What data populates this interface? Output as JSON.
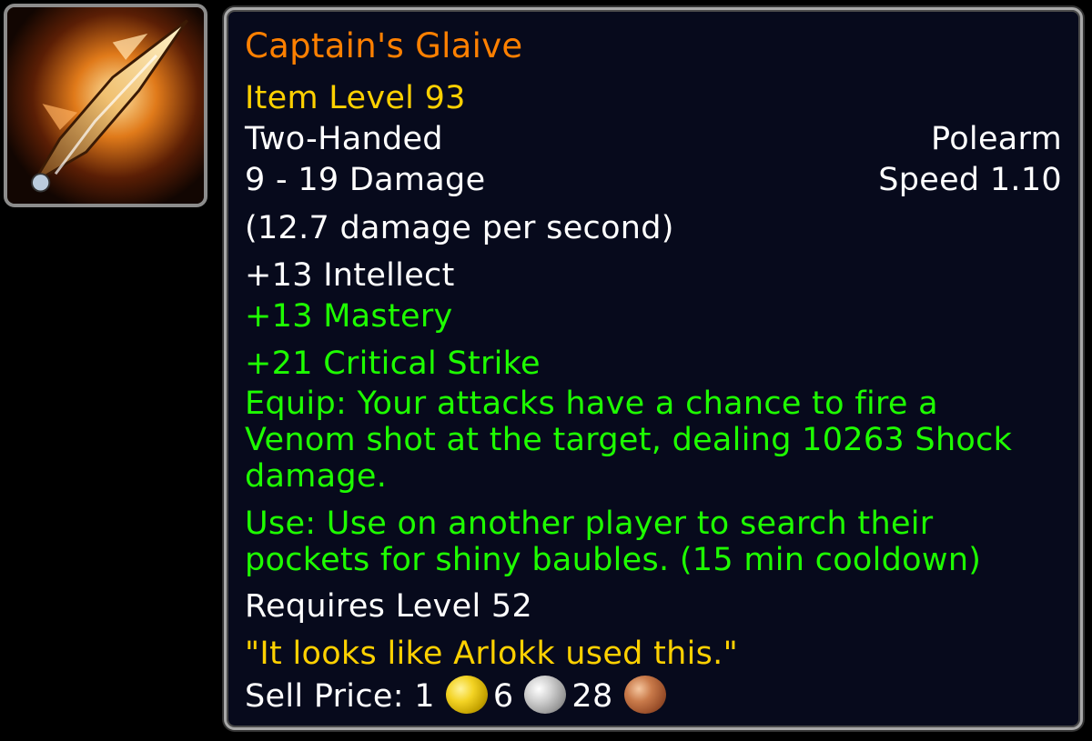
{
  "item": {
    "name": "Captain's Glaive",
    "item_level": "Item Level 93",
    "hand": "Two-Handed",
    "weapon_type": "Polearm",
    "damage": "9 - 19 Damage",
    "speed": "Speed 1.10",
    "dps": "(12.7 damage per second)",
    "stats": {
      "intellect": "+13 Intellect",
      "mastery": "+13 Mastery",
      "crit": "+21 Critical Strike"
    },
    "equip_lines": [
      "Equip: Your attacks have a chance to fire a",
      "Venom shot at the target, dealing 10263 Shock",
      "damage."
    ],
    "use_lines": [
      "Use: Use on another player to search their",
      "pockets for shiny baubles. (15 min cooldown)"
    ],
    "requires": "Requires Level 52",
    "flavor": "\"It looks like Arlokk used this.\"",
    "sell": {
      "label": "Sell Price: ",
      "gold": "1",
      "silver": "6",
      "copper": "28"
    },
    "icon": "polearm-glaive-icon"
  },
  "colors": {
    "name": "#ff8000",
    "item_level": "#ffd100",
    "green_text": "#1eff00",
    "flavor": "#ffd100",
    "background": "#070a1c"
  }
}
